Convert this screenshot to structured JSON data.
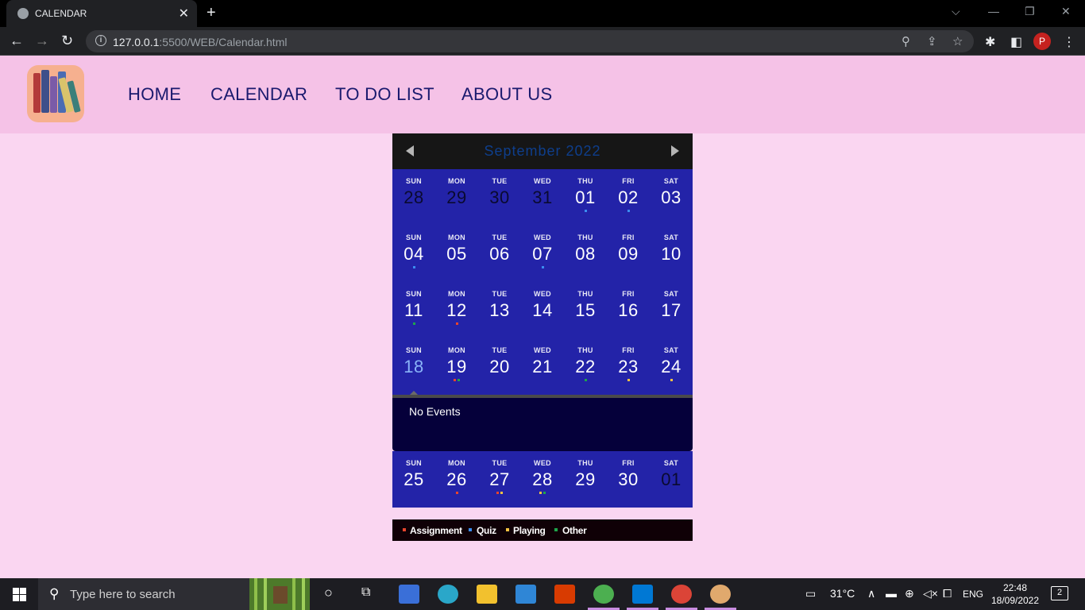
{
  "browser": {
    "tab_title": "CALENDAR",
    "tab_close": "✕",
    "new_tab": "+",
    "url_host": "127.0.0.1",
    "url_rest": ":5500/WEB/Calendar.html",
    "profile_initial": "P"
  },
  "nav": {
    "items": [
      "HOME",
      "CALENDAR",
      "TO DO LIST",
      "ABOUT US"
    ]
  },
  "calendar": {
    "month_label": "September 2022",
    "weeks": [
      {
        "days": [
          {
            "name": "SUN",
            "num": "28",
            "state": "other",
            "dots": []
          },
          {
            "name": "MON",
            "num": "29",
            "state": "other",
            "dots": []
          },
          {
            "name": "TUE",
            "num": "30",
            "state": "other",
            "dots": []
          },
          {
            "name": "WED",
            "num": "31",
            "state": "other",
            "dots": []
          },
          {
            "name": "THU",
            "num": "01",
            "state": "",
            "dots": [
              "quiz"
            ]
          },
          {
            "name": "FRI",
            "num": "02",
            "state": "",
            "dots": [
              "quiz"
            ]
          },
          {
            "name": "SAT",
            "num": "03",
            "state": "",
            "dots": []
          }
        ]
      },
      {
        "days": [
          {
            "name": "SUN",
            "num": "04",
            "state": "",
            "dots": [
              "quiz"
            ]
          },
          {
            "name": "MON",
            "num": "05",
            "state": "",
            "dots": []
          },
          {
            "name": "TUE",
            "num": "06",
            "state": "",
            "dots": []
          },
          {
            "name": "WED",
            "num": "07",
            "state": "",
            "dots": [
              "quiz"
            ]
          },
          {
            "name": "THU",
            "num": "08",
            "state": "",
            "dots": []
          },
          {
            "name": "FRI",
            "num": "09",
            "state": "",
            "dots": []
          },
          {
            "name": "SAT",
            "num": "10",
            "state": "",
            "dots": []
          }
        ]
      },
      {
        "days": [
          {
            "name": "SUN",
            "num": "11",
            "state": "",
            "dots": [
              "other"
            ]
          },
          {
            "name": "MON",
            "num": "12",
            "state": "",
            "dots": [
              "assignment"
            ]
          },
          {
            "name": "TUE",
            "num": "13",
            "state": "",
            "dots": []
          },
          {
            "name": "WED",
            "num": "14",
            "state": "",
            "dots": []
          },
          {
            "name": "THU",
            "num": "15",
            "state": "",
            "dots": []
          },
          {
            "name": "FRI",
            "num": "16",
            "state": "",
            "dots": []
          },
          {
            "name": "SAT",
            "num": "17",
            "state": "",
            "dots": []
          }
        ]
      },
      {
        "days": [
          {
            "name": "SUN",
            "num": "18",
            "state": "today",
            "dots": []
          },
          {
            "name": "MON",
            "num": "19",
            "state": "",
            "dots": [
              "assignment",
              "other"
            ]
          },
          {
            "name": "TUE",
            "num": "20",
            "state": "",
            "dots": []
          },
          {
            "name": "WED",
            "num": "21",
            "state": "",
            "dots": []
          },
          {
            "name": "THU",
            "num": "22",
            "state": "",
            "dots": [
              "other"
            ]
          },
          {
            "name": "FRI",
            "num": "23",
            "state": "",
            "dots": [
              "playing"
            ]
          },
          {
            "name": "SAT",
            "num": "24",
            "state": "",
            "dots": [
              "playing"
            ]
          }
        ]
      },
      {
        "days": [
          {
            "name": "SUN",
            "num": "25",
            "state": "",
            "dots": []
          },
          {
            "name": "MON",
            "num": "26",
            "state": "",
            "dots": [
              "assignment"
            ]
          },
          {
            "name": "TUE",
            "num": "27",
            "state": "",
            "dots": [
              "assignment",
              "playing"
            ]
          },
          {
            "name": "WED",
            "num": "28",
            "state": "",
            "dots": [
              "playing",
              "other"
            ]
          },
          {
            "name": "THU",
            "num": "29",
            "state": "",
            "dots": []
          },
          {
            "name": "FRI",
            "num": "30",
            "state": "",
            "dots": []
          },
          {
            "name": "SAT",
            "num": "01",
            "state": "other",
            "dots": []
          }
        ]
      }
    ],
    "events_text": "No Events"
  },
  "legend": [
    {
      "key": "assignment",
      "label": "Assignment",
      "color": "#e8452c"
    },
    {
      "key": "quiz",
      "label": "Quiz",
      "color": "#3b8df0"
    },
    {
      "key": "playing",
      "label": "Playing",
      "color": "#f6c343"
    },
    {
      "key": "other",
      "label": "Other",
      "color": "#1ea64b"
    }
  ],
  "taskbar": {
    "search_placeholder": "Type here to search",
    "weather": "31°C",
    "language": "ENG",
    "time": "22:48",
    "date": "18/09/2022",
    "notifications": "2"
  }
}
